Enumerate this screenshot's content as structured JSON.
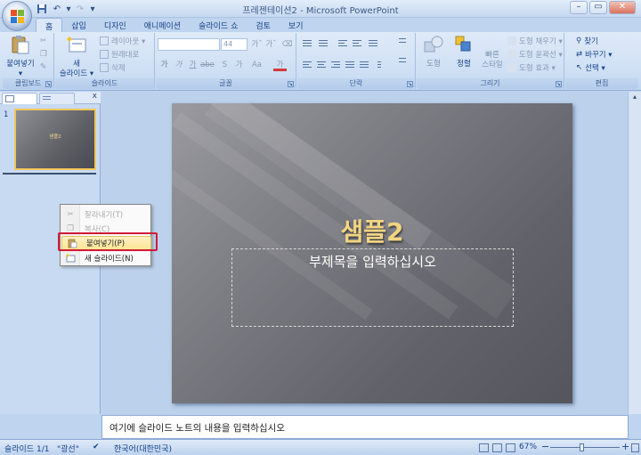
{
  "window": {
    "title": "프레젠테이션2 - Microsoft PowerPoint",
    "minimize": "–",
    "maximize": "▭",
    "close": "✕"
  },
  "qat": {
    "save_icon": "save-icon",
    "undo_label": "↶",
    "redo_label": "↷",
    "dropdown_label": "▾"
  },
  "tabs": [
    "홈",
    "삽입",
    "디자인",
    "애니메이션",
    "슬라이드 쇼",
    "검토",
    "보기"
  ],
  "ribbon": {
    "clipboard": {
      "label": "클립보드",
      "paste": "붙여넣기",
      "paste_arrow": "▾"
    },
    "slides": {
      "label": "슬라이드",
      "new_slide_line1": "새",
      "new_slide_line2": "슬라이드 ▾",
      "layout": "레이아웃 ▾",
      "reset": "원래대로",
      "delete": "삭제"
    },
    "font": {
      "label": "글꼴",
      "font_name": "",
      "font_size": "44",
      "grow": "가ˆ",
      "shrink": "가ˇ",
      "bold": "가",
      "italic": "가",
      "underline": "가",
      "strike": "abe",
      "shadow": "S",
      "spacing": "가",
      "case": "Aa",
      "color": "가"
    },
    "paragraph": {
      "label": "단락"
    },
    "drawing": {
      "label": "그리기",
      "shapes": "도형",
      "arrange": "정렬",
      "quick_styles_line1": "빠른",
      "quick_styles_line2": "스타일",
      "fill": "도형 채우기 ▾",
      "outline": "도형 윤곽선 ▾",
      "effects": "도형 효과 ▾"
    },
    "editing": {
      "label": "편집",
      "find": "찾기",
      "replace": "바꾸기 ▾",
      "select": "선택 ▾"
    }
  },
  "left_panel": {
    "close": "x",
    "slide_number": "1",
    "thumb_title": "샘플2"
  },
  "context_menu": {
    "items": [
      {
        "label": "잘라내기(T)",
        "enabled": false
      },
      {
        "label": "복사(C)",
        "enabled": false
      },
      {
        "label": "붙여넣기(P)",
        "enabled": true
      },
      {
        "label": "새 슬라이드(N)",
        "enabled": true
      }
    ]
  },
  "slide": {
    "title": "샘플2",
    "subtitle": "부제목을 입력하십시오"
  },
  "notes": {
    "text": "여기에 슬라이드 노트의 내용을 입력하십시오"
  },
  "status": {
    "slide_info": "슬라이드 1/1",
    "theme": "\"광선\"",
    "language": "한국어(대한민국)",
    "zoom": "67%",
    "zoom_out": "−",
    "zoom_in": "+"
  },
  "colors": {
    "accent": "#15428b",
    "highlight": "#fde594",
    "red_box": "#d21a38",
    "slide_title": "#f2d583"
  }
}
